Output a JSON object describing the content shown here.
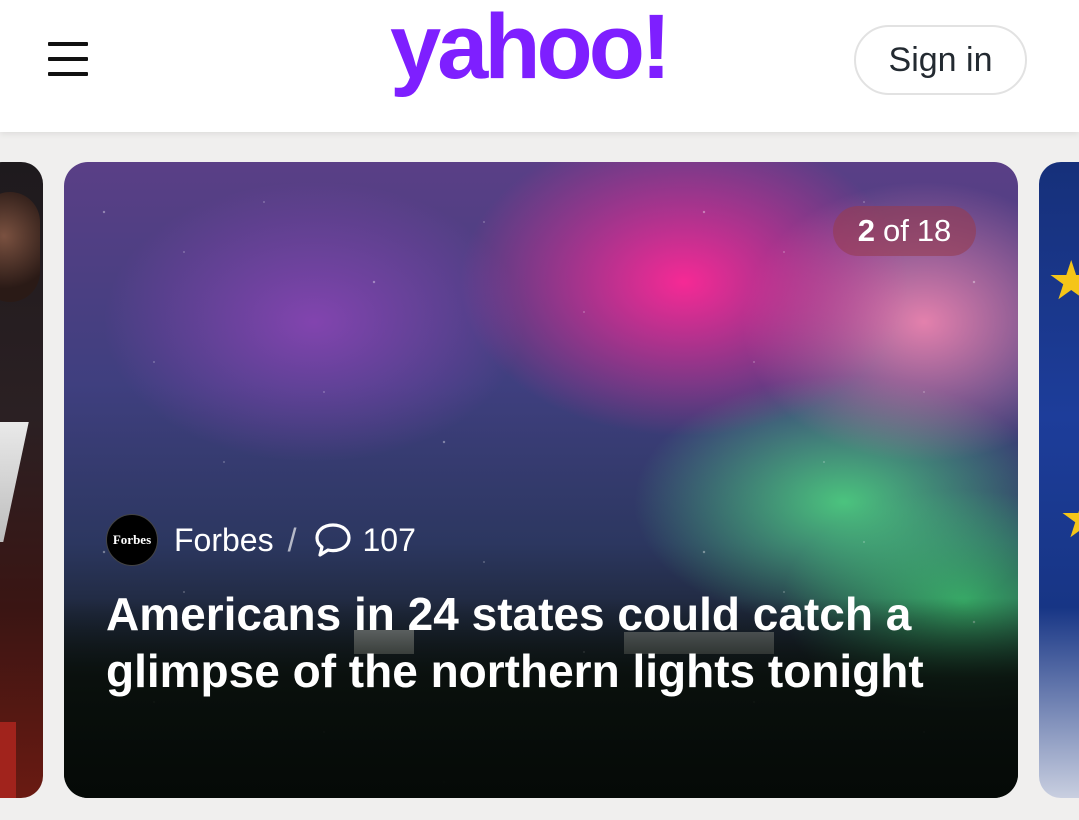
{
  "header": {
    "menu_icon": "hamburger-menu-icon",
    "logo_text": "yahoo!",
    "brand_color": "#7e1fff",
    "sign_in_label": "Sign in"
  },
  "carousel": {
    "current_slide": "2",
    "of_label": "of",
    "total_slides": "18",
    "story": {
      "publisher_logo_text": "Forbes",
      "publisher": "Forbes",
      "separator": "/",
      "comment_icon": "speech-bubble-icon",
      "comment_count": "107",
      "headline": "Americans in 24 states could catch a glimpse of the northern lights tonight"
    }
  }
}
